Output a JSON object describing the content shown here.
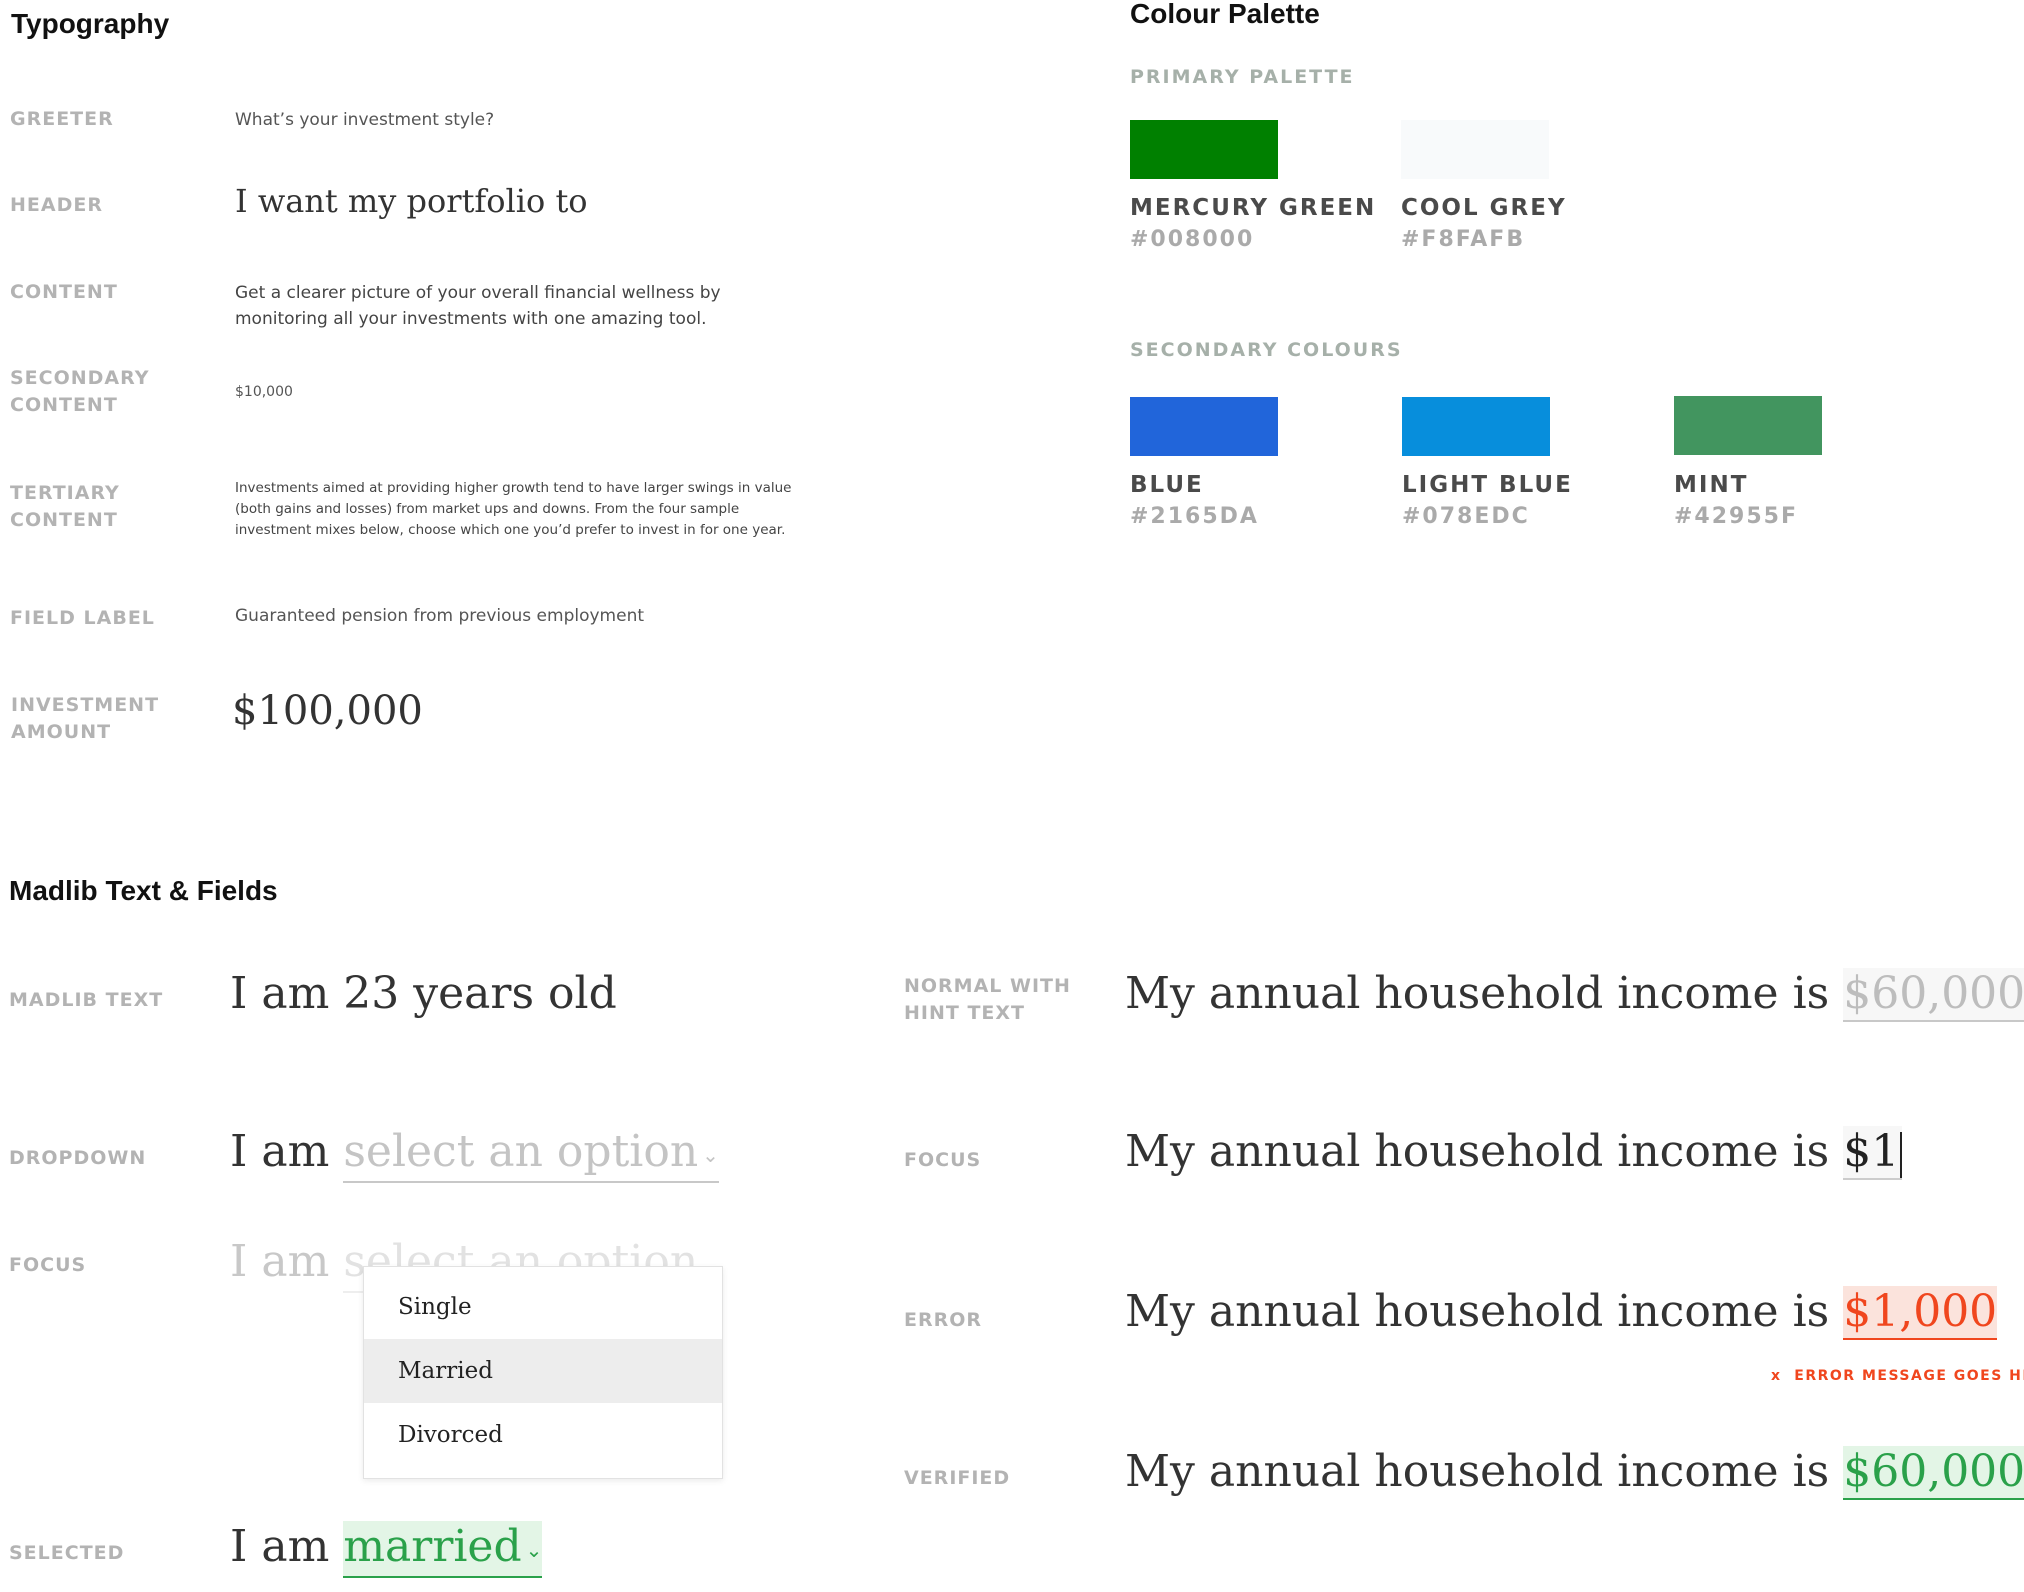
{
  "typography": {
    "title": "Typography",
    "rows": [
      {
        "label": "GREETER",
        "sample": "What’s your investment style?"
      },
      {
        "label": "HEADER",
        "sample": "I want my portfolio to"
      },
      {
        "label": "CONTENT",
        "sample": "Get a clearer picture of your overall financial wellness by monitoring all your investments with one amazing tool."
      },
      {
        "label": "SECONDARY\nCONTENT",
        "sample": "$10,000"
      },
      {
        "label": "TERTIARY\nCONTENT",
        "sample": "Investments aimed at providing higher growth tend to have larger swings in value (both gains and losses) from market ups and downs. From the four sample investment mixes below, choose which one you’d prefer to invest in for one year."
      },
      {
        "label": "FIELD LABEL",
        "sample": "Guaranteed pension from previous employment"
      },
      {
        "label": "INVESTMENT\nAMOUNT",
        "sample": "$100,000"
      }
    ]
  },
  "palette": {
    "title": "Colour Palette",
    "primary_heading": "PRIMARY PALETTE",
    "secondary_heading": "SECONDARY COLOURS",
    "primary": [
      {
        "name": "MERCURY GREEN",
        "hex": "#008000",
        "color": "#008000"
      },
      {
        "name": "COOL GREY",
        "hex": "#F8FAFB",
        "color": "#F8FAFB"
      }
    ],
    "secondary": [
      {
        "name": "BLUE",
        "hex": "#2165DA",
        "color": "#2165DA"
      },
      {
        "name": "LIGHT BLUE",
        "hex": "#078EDC",
        "color": "#078EDC"
      },
      {
        "name": "MINT",
        "hex": "#42955F",
        "color": "#42955F"
      }
    ]
  },
  "madlib": {
    "title": "Madlib Text & Fields",
    "left": {
      "madlib_label": "MADLIB TEXT",
      "madlib_text": "I am 23 years old",
      "dropdown_label": "DROPDOWN",
      "dropdown_prefix": "I am",
      "dropdown_placeholder": "select an option",
      "focus_label": "FOCUS",
      "focus_prefix": "I am",
      "focus_placeholder": "select an option",
      "options": [
        "Single",
        "Married",
        "Divorced"
      ],
      "highlighted_option": "Married",
      "selected_label": "SELECTED",
      "selected_prefix": "I am",
      "selected_value": "married"
    },
    "right": {
      "sentence": "My annual household income is",
      "hint_label": "NORMAL WITH\nHINT TEXT",
      "hint_value": "$60,000",
      "focus_label": "FOCUS",
      "focus_value": "$1",
      "error_label": "ERROR",
      "error_value": "$1,000",
      "error_message": "x  ERROR MESSAGE GOES HERE",
      "verified_label": "VERIFIED",
      "verified_value": "$60,000"
    },
    "colors": {
      "hint": "#bdbdbd",
      "error": "#f0461e",
      "error_bg": "#fbe3dc",
      "verified": "#2aa14a",
      "verified_bg": "#e3f5e6"
    }
  }
}
